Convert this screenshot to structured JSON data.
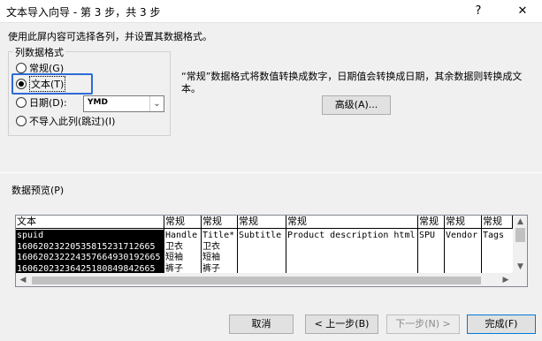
{
  "window": {
    "title": "文本导入向导 - 第 3 步，共 3 步",
    "help_glyph": "?",
    "close_glyph": "✕"
  },
  "instruction": "使用此屏内容可选择各列，并设置其数据格式。",
  "column_format": {
    "legend": "列数据格式",
    "options": [
      "常规(G)",
      "文本(T)",
      "日期(D):",
      "不导入此列(跳过)(I)"
    ],
    "selected": "文本(T)",
    "date_format": "YMD"
  },
  "description": "“常规”数据格式将数值转换成数字，日期值会转换成日期，其余数据则转换成文本。",
  "advanced_button": "高级(A)...",
  "preview": {
    "label": "数据预览(P)",
    "headers": [
      "文本",
      "常规",
      "常规",
      "常规",
      "常规",
      "常规",
      "常规",
      "常规"
    ],
    "rows": [
      [
        "spuid",
        "Handle",
        "Title*",
        "Subtitle",
        "Product description html",
        "SPU",
        "Vendor",
        "Tags"
      ],
      [
        "1606202322053581523171266​5",
        "卫衣",
        "卫衣",
        "",
        "",
        "",
        "",
        ""
      ],
      [
        "16062023222435766493019266​5",
        "短袖",
        "短袖",
        "",
        "",
        "",
        "",
        ""
      ],
      [
        "16062023236425180849842665",
        "裤子",
        "裤子",
        "",
        "",
        "",
        "",
        ""
      ]
    ]
  },
  "buttons": {
    "cancel": "取消",
    "back": "< 上一步(B)",
    "next": "下一步(N) >",
    "finish": "完成(F)"
  },
  "colors": {
    "focus_outline": "#2e6bd6",
    "default_button_border": "#0078d7"
  }
}
